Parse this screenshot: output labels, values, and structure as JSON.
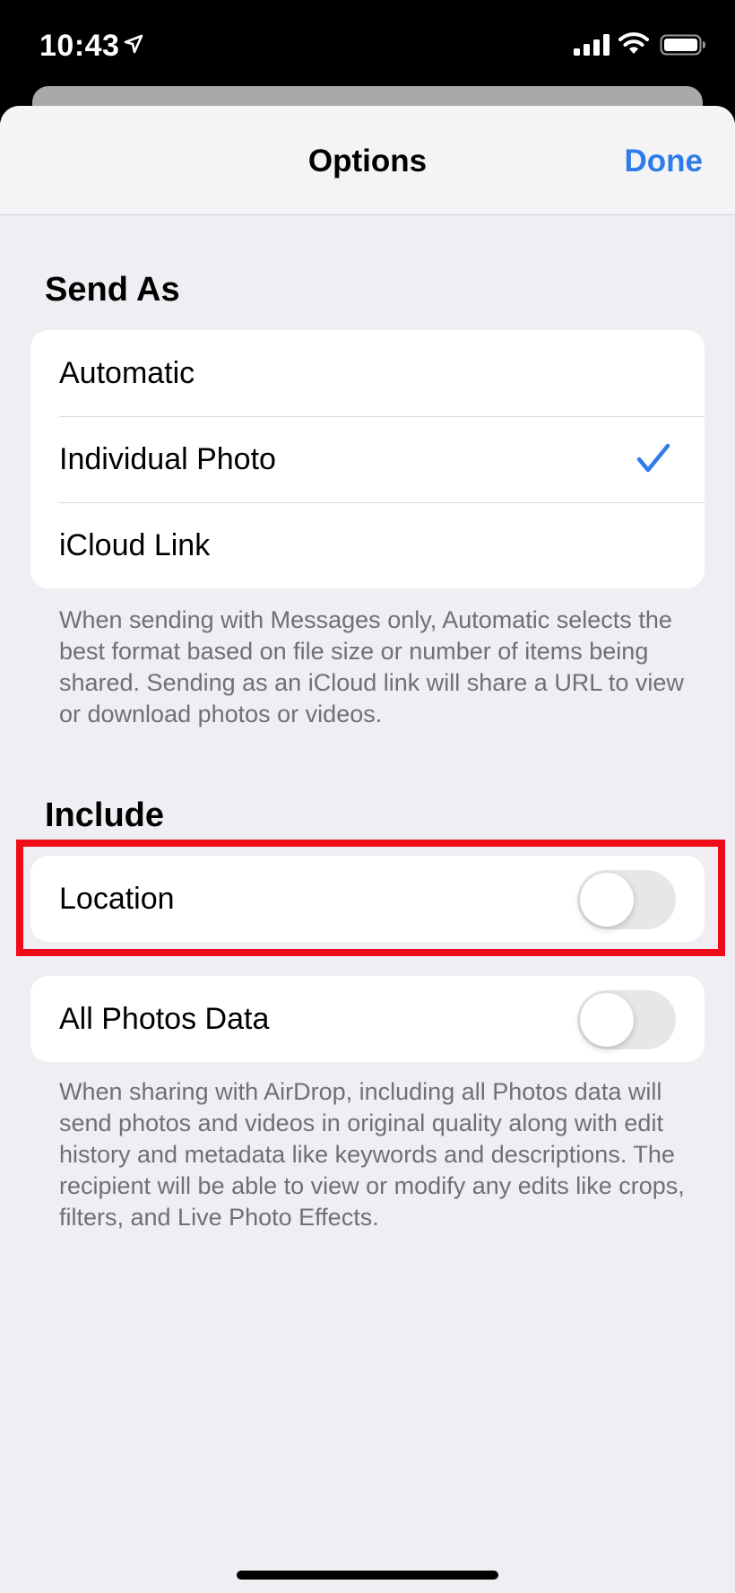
{
  "status_bar": {
    "time": "10:43"
  },
  "nav": {
    "title": "Options",
    "done_label": "Done"
  },
  "send_as": {
    "header": "Send As",
    "options": [
      {
        "label": "Automatic",
        "selected": false
      },
      {
        "label": "Individual Photo",
        "selected": true
      },
      {
        "label": "iCloud Link",
        "selected": false
      }
    ],
    "footer": "When sending with Messages only, Automatic selects the best format based on file size or number of items being shared. Sending as an iCloud link will share a URL to view or download photos or videos."
  },
  "include": {
    "header": "Include",
    "location": {
      "label": "Location",
      "on": false
    },
    "all_photos_data": {
      "label": "All Photos Data",
      "on": false
    },
    "footer": "When sharing with AirDrop, including all Photos data will send photos and videos in original quality along with edit history and metadata like keywords and descriptions. The recipient will be able to view or modify any edits like crops, filters, and Live Photo Effects."
  },
  "colors": {
    "accent": "#2f7ce9",
    "highlight": "#ef0b17",
    "background": "#efeff3",
    "toggle_off": "#e7e7ea"
  },
  "icons": [
    "location-arrow-icon",
    "signal-icon",
    "wifi-icon",
    "battery-icon",
    "checkmark-icon"
  ]
}
